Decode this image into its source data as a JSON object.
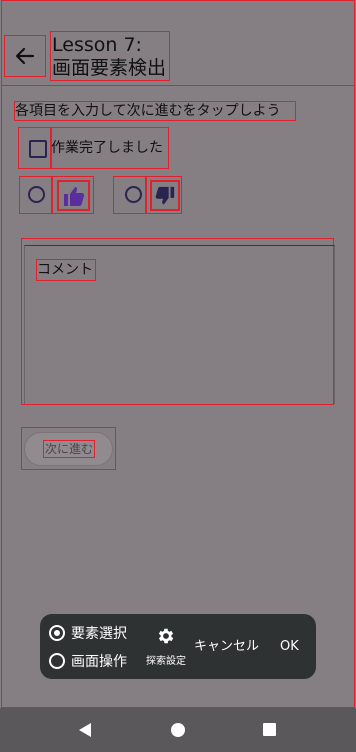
{
  "header": {
    "title_line1": "Lesson 7:",
    "title_line2": "画面要素検出"
  },
  "instruction": "各項目を入力して次に進むをタップしよう",
  "checkbox": {
    "label": "作業完了しました",
    "checked": false
  },
  "comment": {
    "placeholder": "コメント"
  },
  "next_button": {
    "label": "次に進む"
  },
  "toolbar": {
    "option_select": "要素選択",
    "option_operate": "画面操作",
    "selected": "要素選択",
    "settings_label": "探索設定",
    "cancel_label": "キャンセル",
    "ok_label": "OK"
  },
  "icons": {
    "back": "arrow-left-icon",
    "like": "thumbs-up-icon",
    "dislike": "thumbs-down-icon",
    "settings": "gear-icon",
    "nav_back": "triangle-back-icon",
    "nav_home": "circle-home-icon",
    "nav_recents": "square-recents-icon"
  },
  "colors": {
    "background": "#857f84",
    "highlight": "#e0222e",
    "icon_purple": "#5b2ea0",
    "toolbar": "#2f3233"
  }
}
